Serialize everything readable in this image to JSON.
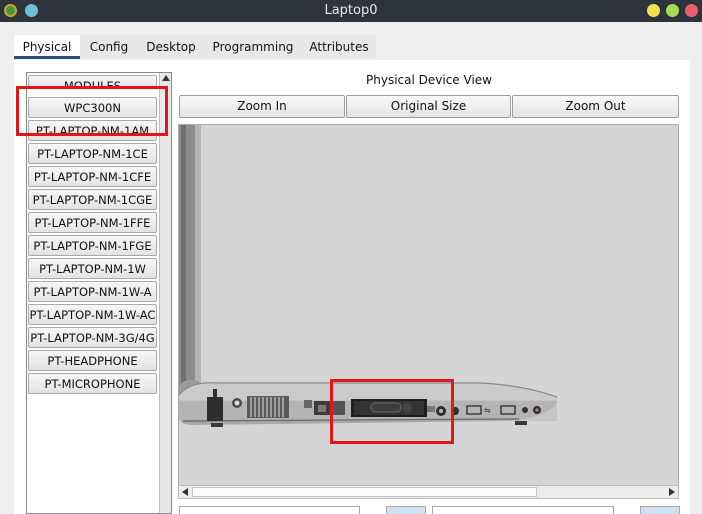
{
  "window": {
    "title": "Laptop0"
  },
  "tabs": [
    {
      "label": "Physical",
      "active": true
    },
    {
      "label": "Config"
    },
    {
      "label": "Desktop"
    },
    {
      "label": "Programming"
    },
    {
      "label": "Attributes"
    }
  ],
  "modules": {
    "header": "MODULES",
    "items": [
      "WPC300N",
      "PT-LAPTOP-NM-1AM",
      "PT-LAPTOP-NM-1CE",
      "PT-LAPTOP-NM-1CFE",
      "PT-LAPTOP-NM-1CGE",
      "PT-LAPTOP-NM-1FFE",
      "PT-LAPTOP-NM-1FGE",
      "PT-LAPTOP-NM-1W",
      "PT-LAPTOP-NM-1W-A",
      "PT-LAPTOP-NM-1W-AC",
      "PT-LAPTOP-NM-3G/4G",
      "PT-HEADPHONE",
      "PT-MICROPHONE"
    ]
  },
  "physical_view": {
    "title": "Physical Device View",
    "zoom_in": "Zoom In",
    "original_size": "Original Size",
    "zoom_out": "Zoom Out"
  },
  "colors": {
    "highlight": "#e0161b",
    "active_tab_underline": "#2d4e86"
  }
}
